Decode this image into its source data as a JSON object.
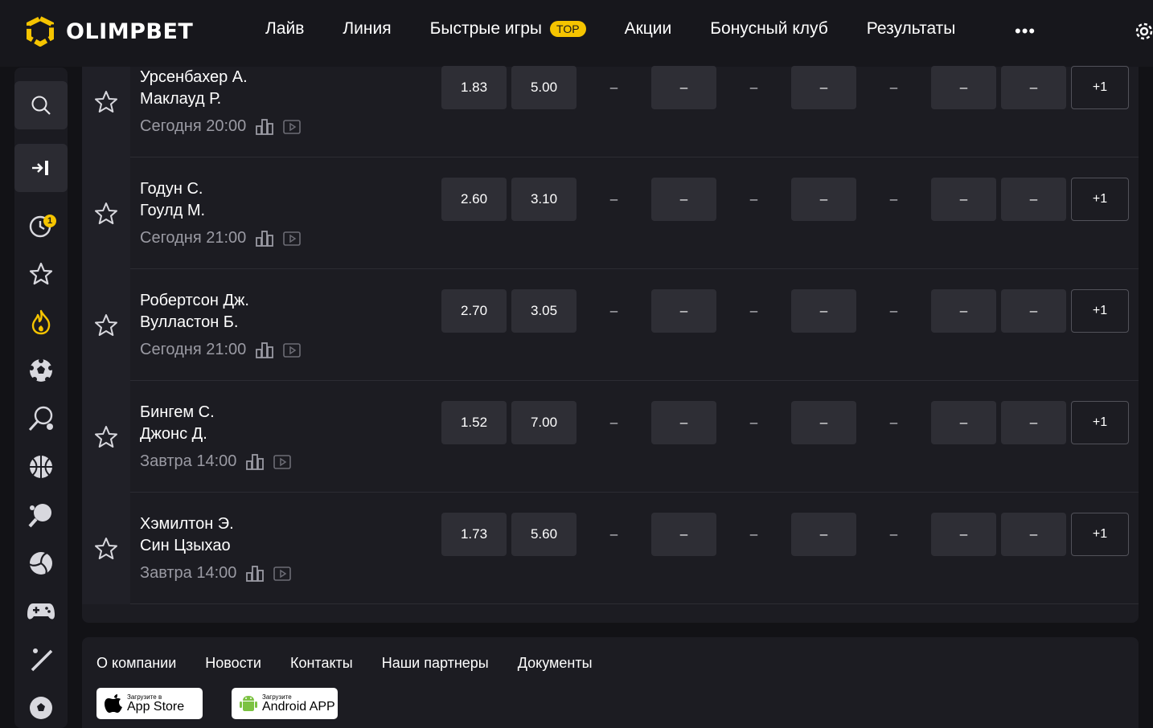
{
  "header": {
    "logo_text": "OLIMPBET",
    "nav": [
      {
        "label": "Лайв"
      },
      {
        "label": "Линия"
      },
      {
        "label": "Быстрые игры",
        "badge": "TOP"
      },
      {
        "label": "Акции"
      },
      {
        "label": "Бонусный клуб"
      },
      {
        "label": "Результаты"
      }
    ],
    "more_label": "•••",
    "accent_color": "#f5c400"
  },
  "sidebar": {
    "badge_count": "1",
    "icons": [
      "search-icon",
      "login-icon",
      "live-clock-icon",
      "star-icon",
      "fire-icon",
      "football-icon",
      "tennis-icon",
      "basketball-icon",
      "table-tennis-icon",
      "volleyball-icon",
      "esports-gamepad-icon",
      "hockey-icon",
      "soccer-ball-icon"
    ]
  },
  "events": [
    {
      "player1": "Урсенбахер А.",
      "player2": "Маклауд Р.",
      "time": "Сегодня 20:00",
      "odds": [
        "1.83",
        "5.00",
        "–",
        "–",
        "–",
        "–",
        "–",
        "–",
        "–"
      ],
      "more": "+1"
    },
    {
      "player1": "Годун С.",
      "player2": "Гоулд М.",
      "time": "Сегодня 21:00",
      "odds": [
        "2.60",
        "3.10",
        "–",
        "–",
        "–",
        "–",
        "–",
        "–",
        "–"
      ],
      "more": "+1"
    },
    {
      "player1": "Робертсон Дж.",
      "player2": "Вулластон Б.",
      "time": "Сегодня 21:00",
      "odds": [
        "2.70",
        "3.05",
        "–",
        "–",
        "–",
        "–",
        "–",
        "–",
        "–"
      ],
      "more": "+1"
    },
    {
      "player1": "Бингем С.",
      "player2": "Джонс Д.",
      "time": "Завтра 14:00",
      "odds": [
        "1.52",
        "7.00",
        "–",
        "–",
        "–",
        "–",
        "–",
        "–",
        "–"
      ],
      "more": "+1"
    },
    {
      "player1": "Хэмилтон Э.",
      "player2": "Син Цзыхао",
      "time": "Завтра 14:00",
      "odds": [
        "1.73",
        "5.60",
        "–",
        "–",
        "–",
        "–",
        "–",
        "–",
        "–"
      ],
      "more": "+1"
    }
  ],
  "footer": {
    "links": [
      "О компании",
      "Новости",
      "Контакты",
      "Наши партнеры",
      "Документы"
    ],
    "appstore_small": "Загрузите в",
    "appstore_big": "App Store",
    "android_small": "Загрузите",
    "android_big": "Android APP"
  }
}
